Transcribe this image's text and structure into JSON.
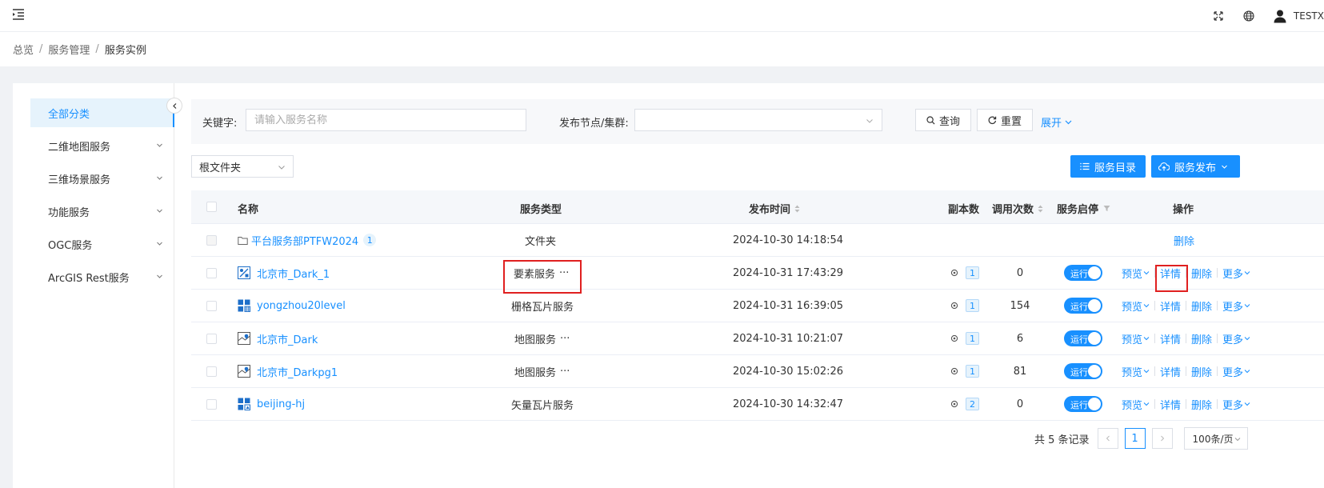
{
  "header": {
    "user_name": "TESTX"
  },
  "breadcrumb": [
    "总览",
    "服务管理",
    "服务实例"
  ],
  "sidebar": {
    "items": [
      {
        "label": "全部分类",
        "active": true,
        "has_children": false
      },
      {
        "label": "二维地图服务",
        "active": false,
        "has_children": true
      },
      {
        "label": "三维场景服务",
        "active": false,
        "has_children": true
      },
      {
        "label": "功能服务",
        "active": false,
        "has_children": true
      },
      {
        "label": "OGC服务",
        "active": false,
        "has_children": true
      },
      {
        "label": "ArcGIS Rest服务",
        "active": false,
        "has_children": true
      }
    ]
  },
  "search": {
    "keyword_label": "关键字:",
    "keyword_placeholder": "请输入服务名称",
    "keyword_value": "",
    "node_label": "发布节点/集群:",
    "node_value": "",
    "query_label": "查询",
    "reset_label": "重置",
    "expand_label": "展开"
  },
  "toolbar": {
    "folder_select": "根文件夹",
    "catalog_label": "服务目录",
    "publish_label": "服务发布"
  },
  "table": {
    "headers": {
      "name": "名称",
      "type": "服务类型",
      "publish_time": "发布时间",
      "replicas": "副本数",
      "calls": "调用次数",
      "status": "服务启停",
      "actions": "操作"
    },
    "rows": [
      {
        "kind": "folder",
        "name": "平台服务部PTFW2024",
        "count": "1",
        "type": "文件夹",
        "time": "2024-10-30 14:18:54",
        "actions": [
          "删除"
        ]
      },
      {
        "kind": "feature",
        "name": "北京市_Dark_1",
        "type": "要素服务",
        "type_more": "···",
        "time": "2024-10-31 17:43:29",
        "replicas": "1",
        "calls": "0",
        "status": "运行",
        "actions": [
          "预览",
          "详情",
          "删除",
          "更多"
        ]
      },
      {
        "kind": "tile",
        "name": "yongzhou20level",
        "type": "栅格瓦片服务",
        "type_more": "",
        "time": "2024-10-31 16:39:05",
        "replicas": "1",
        "calls": "154",
        "status": "运行",
        "actions": [
          "预览",
          "详情",
          "删除",
          "更多"
        ]
      },
      {
        "kind": "map",
        "name": "北京市_Dark",
        "type": "地图服务",
        "type_more": "···",
        "time": "2024-10-31 10:21:07",
        "replicas": "1",
        "calls": "6",
        "status": "运行",
        "actions": [
          "预览",
          "详情",
          "删除",
          "更多"
        ]
      },
      {
        "kind": "map",
        "name": "北京市_Darkpg1",
        "type": "地图服务",
        "type_more": "···",
        "time": "2024-10-30 15:02:26",
        "replicas": "1",
        "calls": "81",
        "status": "运行",
        "actions": [
          "预览",
          "详情",
          "删除",
          "更多"
        ]
      },
      {
        "kind": "vector",
        "name": "beijing-hj",
        "type": "矢量瓦片服务",
        "type_more": "",
        "time": "2024-10-30 14:32:47",
        "replicas": "2",
        "calls": "0",
        "status": "运行",
        "actions": [
          "预览",
          "详情",
          "删除",
          "更多"
        ]
      }
    ]
  },
  "pagination": {
    "total_text": "共 5 条记录",
    "current_page": "1",
    "page_size": "100条/页"
  },
  "colors": {
    "primary": "#1890ff",
    "highlight": "#e02020"
  }
}
